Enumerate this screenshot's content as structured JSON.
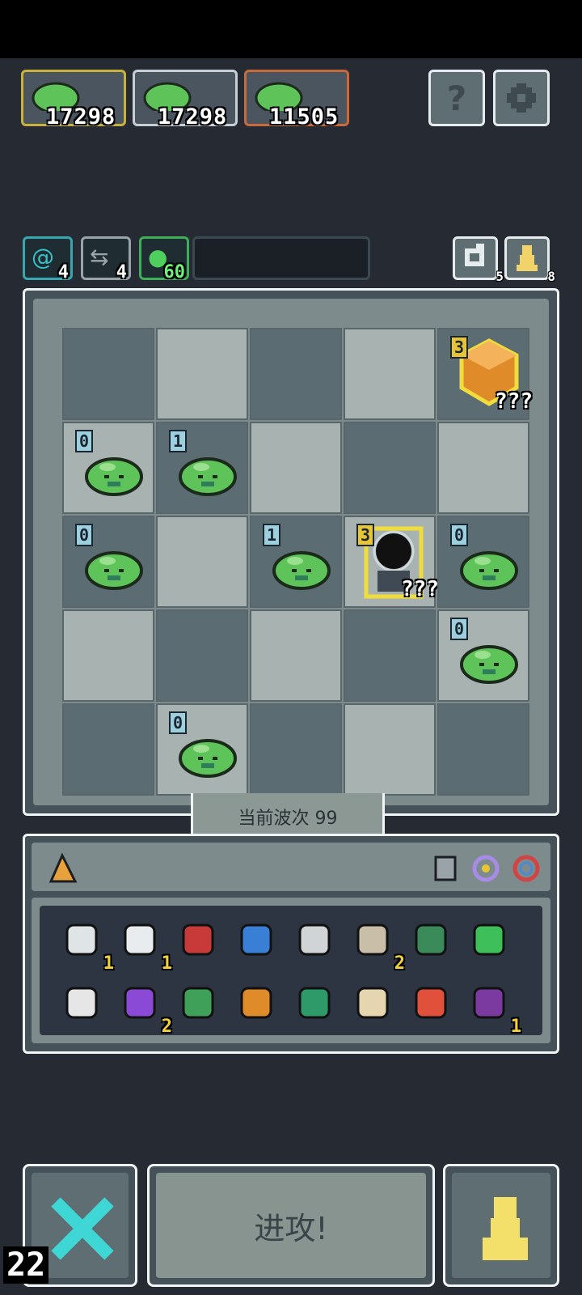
{
  "enemies": [
    {
      "value": "17298",
      "border": "#c9b23a"
    },
    {
      "value": "17298",
      "border": "#c8cfd4"
    },
    {
      "value": "11505",
      "border": "#c86a3a"
    }
  ],
  "top_buttons": {
    "help_label": "?",
    "settings_icon": "gear-icon"
  },
  "stats": {
    "stat1_value": "4",
    "stat2_value": "4",
    "stat3_value": "60",
    "reroll_count": "5",
    "pawn_count": "8"
  },
  "board": {
    "tiles": [
      {
        "row": 0,
        "col": 4,
        "type": "crystal",
        "level": "3",
        "tag": "???"
      },
      {
        "row": 1,
        "col": 0,
        "type": "slime",
        "level": "0"
      },
      {
        "row": 1,
        "col": 1,
        "type": "slime",
        "level": "1"
      },
      {
        "row": 2,
        "col": 0,
        "type": "slime",
        "level": "0"
      },
      {
        "row": 2,
        "col": 2,
        "type": "slime",
        "level": "1"
      },
      {
        "row": 2,
        "col": 3,
        "type": "hole",
        "level": "3",
        "tag": "???"
      },
      {
        "row": 2,
        "col": 4,
        "type": "slime",
        "level": "0"
      },
      {
        "row": 3,
        "col": 4,
        "type": "slime",
        "level": "0"
      },
      {
        "row": 4,
        "col": 1,
        "type": "slime",
        "level": "0"
      }
    ]
  },
  "wave_label": "当前波次 99",
  "inventory": {
    "items": [
      {
        "name": "scroll-icon",
        "count": "1"
      },
      {
        "name": "bone-icon",
        "count": "1"
      },
      {
        "name": "crab-claw-icon",
        "count": ""
      },
      {
        "name": "water-wave-icon",
        "count": ""
      },
      {
        "name": "slingshot-icon",
        "count": ""
      },
      {
        "name": "map-icon",
        "count": "2"
      },
      {
        "name": "spikes-icon",
        "count": ""
      },
      {
        "name": "green-sword-icon",
        "count": ""
      },
      {
        "name": "scythe-icon",
        "count": ""
      },
      {
        "name": "potion-jar-icon",
        "count": "2"
      },
      {
        "name": "green-axe-icon",
        "count": ""
      },
      {
        "name": "orange-pick-icon",
        "count": ""
      },
      {
        "name": "green-orb-icon",
        "count": ""
      },
      {
        "name": "claw-trap-icon",
        "count": ""
      },
      {
        "name": "red-banner-icon",
        "count": ""
      },
      {
        "name": "demon-mask-icon",
        "count": "1"
      }
    ]
  },
  "bottom": {
    "attack_label": "进攻!",
    "frame_counter": "22"
  }
}
